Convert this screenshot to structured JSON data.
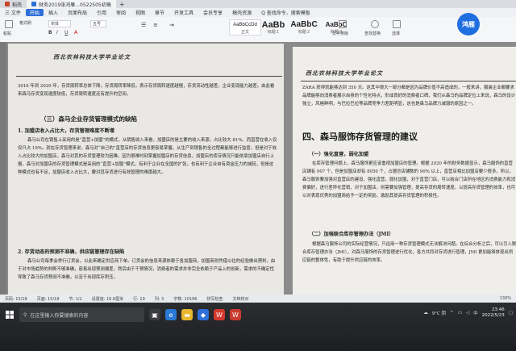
{
  "titlebar": {
    "tabs": [
      "稻壳",
      "财务2019张鸿雁...0522505初稿"
    ],
    "new_tab": "+"
  },
  "menubar": {
    "items": [
      "三 文件",
      "开始",
      "插入",
      "页面布局",
      "引用",
      "审阅",
      "视图",
      "章节",
      "开发工具",
      "会员专享",
      "稿壳资源",
      "Q 查找命令、搜索模板"
    ],
    "right": "≡ 张鸿雁"
  },
  "ribbon": {
    "paste": "粘贴",
    "format_painter": "格式刷",
    "font_name": "宋体",
    "font_size": "五号",
    "styles": [
      {
        "sample": "AaBbCcDd",
        "name": "正文"
      },
      {
        "sample": "AaBb",
        "name": "标题 1"
      },
      {
        "sample": "AaBbC",
        "name": "标题 2"
      },
      {
        "sample": "AaBbC",
        "name": "标题 3"
      }
    ],
    "text_layout": "文字排版",
    "find_replace": "查找替换",
    "select": "选择"
  },
  "avatar": {
    "label": "鸿雁"
  },
  "left_page": {
    "logo": "西北农林科技大学毕业论文",
    "para1": "2016 年到 2020 年，存货周转率总体下降，存货周转率降低，表示存货周转速度越慢，存货流动性越差，企业变现能力越差。由此看来森马存货变现速度较低，存货周转速度还有提升的空间。",
    "h2": "（三）森马企业存货管理模式的缺陷",
    "h3a": "1. 加盟店收入占比大，存货管理难度不断增",
    "para2": "森马公司在销售上采用的是“直营+加盟”的模式，从销售收入来看，加盟店的是主要的收入来源，占比较大 81%。而直营在收入仅仅只占 19%。就在存货管理来说，森马对“自己的”直营店的存货信息更容易掌握，从生产到销售的全过程都能够进行监管，但是对于收入占比较大的加盟店，森马对其的存货管理较为困难。因为很难时刻掌握加盟店的存货信息，加盟店的库存情况只能依靠加盟店自行上报，森马对加盟店的存货管理模式是采用的“直营+加盟”模式，有利于企业在全国的扩张，也有利于企业自有资金压力的减轻，但是这种模式也有不足，加盟店收入占比大，要对其存货进行有效管理的难度越大。",
    "h3b": "2. 存货动态的预测不准确，供应链管理存在缺陷",
    "para3": "森马公司每季会举行订货会，以此来确定供应商下单。订货会的信息来源依赖于各加盟商，加盟商则凭借以往的经验做出预判，由于对市场趋势的判断不够准确，容易出现预测偏差，然后由于干预情况，消费者的需求并非完全依赖于产品上的创新，需求的不确定性导致了森马存货预测不准确，以至于出现库存积压。"
  },
  "right_page": {
    "logo": "西北农林科技大学毕业论文",
    "para1": "ZARA 获得就能够达到 350 天。这其中很大一部分都是因为品牌价值不高造成的，一般来讲，服装企业都要求品牌能够向消费者展示自身的个性化特点，形成良好的消费者口碑，我们从森马的品牌定位上来说，森马的设计独立，风格鲜明，与巴拉巴拉等品牌竞争力差距明显，这也是森马品牌力减弱的原因之一。",
    "h1": "四、森马服饰存货管理的建议",
    "h3a": "（一）强化直营，弱化加盟",
    "para2": "在库存管理问题上，森马服饰更应该重视加盟店的管理。根据 2020 年的财务数据显示，森马服饰的直营店铺有 907 个，但是加盟店却有 8050 个，占据总店铺数的 90% 以上，直营店相比加盟店要少很多。所以，森马服饰要加强对直营店的建设，强化直营，弱化加盟，对于直营门店，可以结合门店所在地区的消费能力和消费偏好，进行差异化营销，对于加盟店，则需要加强管理，提高存货的周转速度，以提高存货管理的效率，也可以对表现优秀的加盟商给予一定的奖励，激励其提高存货管理的积极性。",
    "h3b": "（二）加强联合库存管理办法（JMI）",
    "para3": "根据森马服饰公司的实际经营情况，只运用一种存货管理模式无法解决问题。在综合分析之后，可以引入联合库存管理办法（JMI），对森马服饰的存货管理进行优化，各方共同对存货进行管理，JMI 更加能够体现出供应链的整体性，有助于提升供应链的效率。"
  },
  "statusbar": {
    "page": "页码: 15/18",
    "pages": "页面: 15/18",
    "section": "节: 1/1",
    "setting": "设置值: 16.6厘米",
    "row": "行: 19",
    "col": "列: 3",
    "words": "字数: 10196",
    "spell": "拼写检查",
    "doc_check": "文档校对",
    "zoom": "130%"
  },
  "taskbar": {
    "search_placeholder": "在这里输入你要搜索的内容",
    "weather": "9°C 阴",
    "time": "23:46",
    "date": "2022/5/23",
    "ime": "中"
  },
  "colors": {
    "accent": "#2f6fd8",
    "avatar": "#1f6fe0",
    "taskbar": "#202124"
  }
}
